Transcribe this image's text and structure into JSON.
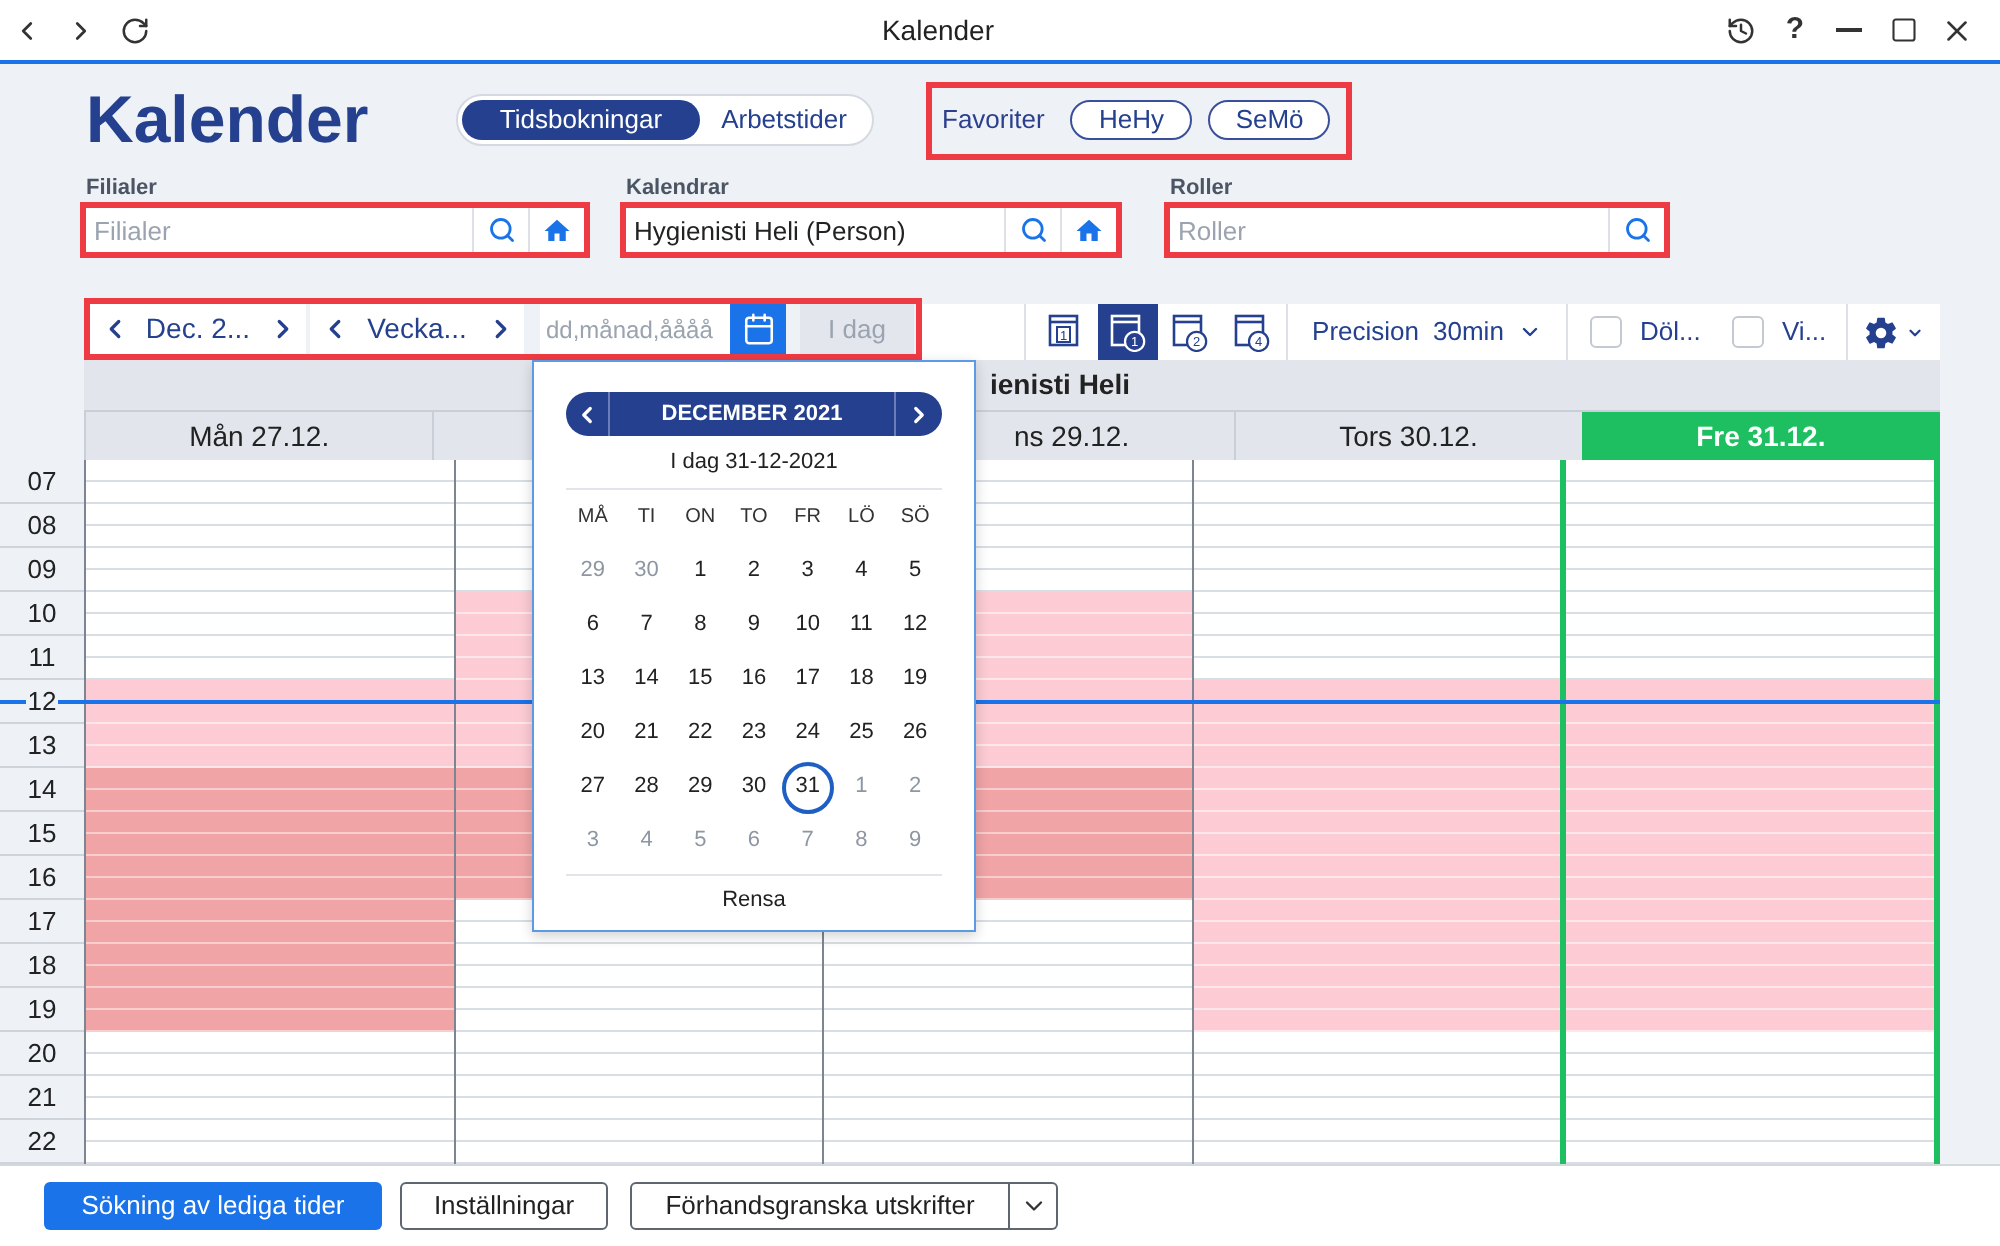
{
  "window": {
    "title": "Kalender",
    "help": "?"
  },
  "header": {
    "title": "Kalender",
    "view_switch": [
      {
        "label": "Tidsbokningar",
        "selected": true
      },
      {
        "label": "Arbetstider",
        "selected": false
      }
    ],
    "favorites": {
      "highlighted": true,
      "label": "Favoriter",
      "items": [
        "HeHy",
        "SeMö"
      ]
    }
  },
  "filters": [
    {
      "label": "Filialer",
      "placeholder": "Filialer",
      "home_button": true,
      "highlighted": true
    },
    {
      "label": "Kalendrar",
      "value": "Hygienisti Heli (Person)",
      "home_button": true,
      "highlighted": true
    },
    {
      "label": "Roller",
      "placeholder": "Roller",
      "home_button": false,
      "highlighted": true
    }
  ],
  "toolbar": {
    "navigation": {
      "highlighted": true,
      "month": "Dec. 2...",
      "week": "Vecka...",
      "date_input": {
        "placeholder": "dd,månad,åååå"
      },
      "today_button": {
        "label": "I dag",
        "disabled": true
      }
    },
    "views": [
      {
        "number": "1",
        "kind": "square",
        "selected": false
      },
      {
        "number": "1",
        "kind": "circle",
        "selected": true
      },
      {
        "number": "2",
        "kind": "circle",
        "selected": false
      },
      {
        "number": "4",
        "kind": "circle",
        "selected": false
      }
    ],
    "precision": {
      "label": "Precision",
      "value": "30min"
    },
    "checkboxes": [
      {
        "label": "Döl...",
        "checked": false
      },
      {
        "label": "Vi...",
        "checked": false
      }
    ]
  },
  "calendar": {
    "resource": {
      "label": "ienisti Heli",
      "cut_left": true
    },
    "days": [
      {
        "label": "Mån 27.12.",
        "today": false,
        "cut_left": false
      },
      {
        "today": false
      },
      {
        "label": "ns 29.12.",
        "today": false,
        "cut_left": true
      },
      {
        "label": "Tors 30.12.",
        "today": false,
        "cut_left": false
      },
      {
        "label": "Fre 31.12.",
        "today": true,
        "cut_left": false
      }
    ],
    "hours": [
      {
        "label": "07",
        "cells": [
          {
            "kind": "empty"
          },
          {
            "kind": "empty"
          },
          {
            "kind": "empty"
          },
          {
            "kind": "empty"
          },
          {
            "kind": "empty"
          }
        ]
      },
      {
        "label": "08",
        "cells": [
          {
            "kind": "empty"
          },
          {
            "kind": "empty"
          },
          {
            "kind": "empty"
          },
          {
            "kind": "empty"
          },
          {
            "kind": "empty"
          }
        ]
      },
      {
        "label": "09",
        "cells": [
          {
            "kind": "empty"
          },
          {
            "kind": "empty"
          },
          {
            "kind": "empty"
          },
          {
            "kind": "empty"
          },
          {
            "kind": "empty"
          }
        ]
      },
      {
        "label": "10",
        "cells": [
          {
            "kind": "empty"
          },
          {
            "kind": "light"
          },
          {
            "kind": "light"
          },
          {
            "kind": "empty"
          },
          {
            "kind": "empty"
          }
        ]
      },
      {
        "label": "11",
        "cells": [
          {
            "kind": "empty"
          },
          {
            "kind": "light"
          },
          {
            "kind": "light"
          },
          {
            "kind": "empty"
          },
          {
            "kind": "empty"
          }
        ]
      },
      {
        "label": "12",
        "cells": [
          {
            "kind": "light"
          },
          {
            "kind": "light"
          },
          {
            "kind": "light"
          },
          {
            "kind": "light"
          },
          {
            "kind": "light"
          }
        ]
      },
      {
        "label": "13",
        "cells": [
          {
            "kind": "light"
          },
          {
            "kind": "light"
          },
          {
            "kind": "light"
          },
          {
            "kind": "light"
          },
          {
            "kind": "light"
          }
        ]
      },
      {
        "label": "14",
        "cells": [
          {
            "kind": "dark"
          },
          {
            "kind": "dark"
          },
          {
            "kind": "dark"
          },
          {
            "kind": "light"
          },
          {
            "kind": "light"
          }
        ]
      },
      {
        "label": "15",
        "cells": [
          {
            "kind": "dark"
          },
          {
            "kind": "dark"
          },
          {
            "kind": "dark"
          },
          {
            "kind": "light"
          },
          {
            "kind": "light"
          }
        ]
      },
      {
        "label": "16",
        "cells": [
          {
            "kind": "dark"
          },
          {
            "kind": "dark"
          },
          {
            "kind": "dark"
          },
          {
            "kind": "light"
          },
          {
            "kind": "light"
          }
        ]
      },
      {
        "label": "17",
        "cells": [
          {
            "kind": "dark"
          },
          {
            "kind": "empty"
          },
          {
            "kind": "empty"
          },
          {
            "kind": "light"
          },
          {
            "kind": "light"
          }
        ]
      },
      {
        "label": "18",
        "cells": [
          {
            "kind": "dark"
          },
          {
            "kind": "empty"
          },
          {
            "kind": "empty"
          },
          {
            "kind": "light"
          },
          {
            "kind": "light"
          }
        ]
      },
      {
        "label": "19",
        "cells": [
          {
            "kind": "dark"
          },
          {
            "kind": "empty"
          },
          {
            "kind": "empty"
          },
          {
            "kind": "light"
          },
          {
            "kind": "light"
          }
        ]
      },
      {
        "label": "20",
        "cells": [
          {
            "kind": "empty"
          },
          {
            "kind": "empty"
          },
          {
            "kind": "empty"
          },
          {
            "kind": "empty"
          },
          {
            "kind": "empty"
          }
        ]
      },
      {
        "label": "21",
        "cells": [
          {
            "kind": "empty"
          },
          {
            "kind": "empty"
          },
          {
            "kind": "empty"
          },
          {
            "kind": "empty"
          },
          {
            "kind": "empty"
          }
        ]
      },
      {
        "label": "22",
        "cells": [
          {
            "kind": "empty"
          },
          {
            "kind": "empty"
          },
          {
            "kind": "empty"
          },
          {
            "kind": "empty"
          },
          {
            "kind": "empty"
          }
        ]
      }
    ],
    "now_line": {
      "level": 0.345
    }
  },
  "datepicker": {
    "month": "DECEMBER 2021",
    "today": "I dag 31-12-2021",
    "weekdays": [
      "MÅ",
      "TI",
      "ON",
      "TO",
      "FR",
      "LÖ",
      "SÖ"
    ],
    "weeks": [
      [
        {
          "day": "29",
          "outside": true,
          "selected": false
        },
        {
          "day": "30",
          "outside": true,
          "selected": false
        },
        {
          "day": "1",
          "outside": false,
          "selected": false
        },
        {
          "day": "2",
          "outside": false,
          "selected": false
        },
        {
          "day": "3",
          "outside": false,
          "selected": false
        },
        {
          "day": "4",
          "outside": false,
          "selected": false
        },
        {
          "day": "5",
          "outside": false,
          "selected": false
        }
      ],
      [
        {
          "day": "6",
          "outside": false,
          "selected": false
        },
        {
          "day": "7",
          "outside": false,
          "selected": false
        },
        {
          "day": "8",
          "outside": false,
          "selected": false
        },
        {
          "day": "9",
          "outside": false,
          "selected": false
        },
        {
          "day": "10",
          "outside": false,
          "selected": false
        },
        {
          "day": "11",
          "outside": false,
          "selected": false
        },
        {
          "day": "12",
          "outside": false,
          "selected": false
        }
      ],
      [
        {
          "day": "13",
          "outside": false,
          "selected": false
        },
        {
          "day": "14",
          "outside": false,
          "selected": false
        },
        {
          "day": "15",
          "outside": false,
          "selected": false
        },
        {
          "day": "16",
          "outside": false,
          "selected": false
        },
        {
          "day": "17",
          "outside": false,
          "selected": false
        },
        {
          "day": "18",
          "outside": false,
          "selected": false
        },
        {
          "day": "19",
          "outside": false,
          "selected": false
        }
      ],
      [
        {
          "day": "20",
          "outside": false,
          "selected": false
        },
        {
          "day": "21",
          "outside": false,
          "selected": false
        },
        {
          "day": "22",
          "outside": false,
          "selected": false
        },
        {
          "day": "23",
          "outside": false,
          "selected": false
        },
        {
          "day": "24",
          "outside": false,
          "selected": false
        },
        {
          "day": "25",
          "outside": false,
          "selected": false
        },
        {
          "day": "26",
          "outside": false,
          "selected": false
        }
      ],
      [
        {
          "day": "27",
          "outside": false,
          "selected": false
        },
        {
          "day": "28",
          "outside": false,
          "selected": false
        },
        {
          "day": "29",
          "outside": false,
          "selected": false
        },
        {
          "day": "30",
          "outside": false,
          "selected": false
        },
        {
          "day": "31",
          "outside": false,
          "selected": true
        },
        {
          "day": "1",
          "outside": true,
          "selected": false
        },
        {
          "day": "2",
          "outside": true,
          "selected": false
        }
      ],
      [
        {
          "day": "3",
          "outside": true,
          "selected": false
        },
        {
          "day": "4",
          "outside": true,
          "selected": false
        },
        {
          "day": "5",
          "outside": true,
          "selected": false
        },
        {
          "day": "6",
          "outside": true,
          "selected": false
        },
        {
          "day": "7",
          "outside": true,
          "selected": false
        },
        {
          "day": "8",
          "outside": true,
          "selected": false
        },
        {
          "day": "9",
          "outside": true,
          "selected": false
        }
      ]
    ],
    "clear": "Rensa"
  },
  "footer": {
    "buttons": [
      {
        "label": "Sökning av lediga tider",
        "kind": "primary"
      },
      {
        "label": "Inställningar",
        "kind": "outline"
      },
      {
        "label": "Förhandsgranska utskrifter",
        "kind": "split"
      }
    ]
  }
}
